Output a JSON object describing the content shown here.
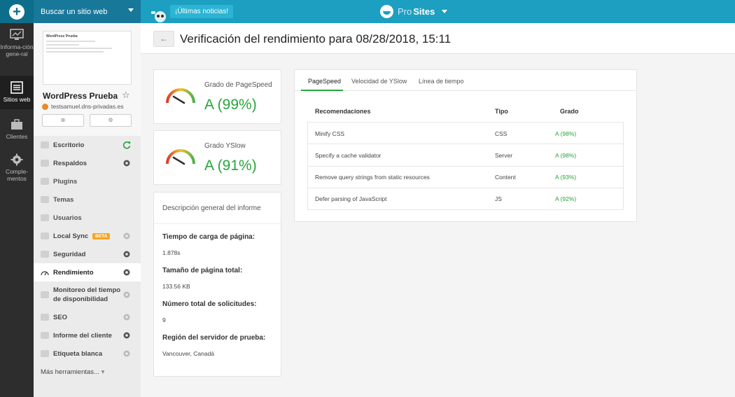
{
  "topbar": {
    "search_label": "Buscar un sitio web",
    "news_label": "¡Últimas noticias!",
    "brand_pro": "Pro",
    "brand_sites": "Sites"
  },
  "rail": {
    "items": [
      {
        "label": "Informa-ción gene-ral",
        "icon": "monitor-icon"
      },
      {
        "label": "Sitios web",
        "icon": "sites-icon"
      },
      {
        "label": "Clientes",
        "icon": "clients-icon"
      },
      {
        "label": "Comple-mentos",
        "icon": "gear-icon"
      }
    ]
  },
  "site": {
    "thumb_title": "WordPress Prueba",
    "name": "WordPress Prueba",
    "url": "testsamuel.dns-privadas.es"
  },
  "nav": {
    "items": [
      {
        "label": "Escritorio",
        "icon": "desktop-icon"
      },
      {
        "label": "Respaldos",
        "icon": "backup-icon"
      },
      {
        "label": "Plugins",
        "icon": "plugin-icon"
      },
      {
        "label": "Temas",
        "icon": "theme-icon"
      },
      {
        "label": "Usuarios",
        "icon": "users-icon"
      },
      {
        "label": "Local Sync",
        "icon": "sync-icon",
        "badge": "BETA"
      },
      {
        "label": "Seguridad",
        "icon": "shield-icon"
      },
      {
        "label": "Rendimiento",
        "icon": "speedometer-icon"
      },
      {
        "label": "Monitoreo del tiempo de disponibilidad",
        "icon": "uptime-icon"
      },
      {
        "label": "SEO",
        "icon": "megaphone-icon"
      },
      {
        "label": "Informe del cliente",
        "icon": "report-icon"
      },
      {
        "label": "Etiqueta blanca",
        "icon": "tag-icon"
      }
    ],
    "more_label": "Más herramientas..."
  },
  "page": {
    "title": "Verificación del rendimiento para 08/28/2018, 15:11",
    "back_label": "←"
  },
  "scores": [
    {
      "label": "Grado de PageSpeed",
      "value": "A (99%)",
      "percent": 99
    },
    {
      "label": "Grado YSlow",
      "value": "A (91%)",
      "percent": 91
    }
  ],
  "report": {
    "title": "Descripción general del informe",
    "fields": [
      {
        "key": "Tiempo de carga de página:",
        "value": "1.878s"
      },
      {
        "key": "Tamaño de página total:",
        "value": "133.56 KB"
      },
      {
        "key": "Número total de solicitudes:",
        "value": "9"
      },
      {
        "key": "Región del servidor de prueba:",
        "value": "Vancouver, Canadá"
      }
    ]
  },
  "results": {
    "tabs": [
      "PageSpeed",
      "Velocidad de YSlow",
      "Línea de tiempo"
    ],
    "active_tab": "PageSpeed",
    "columns": [
      "Recomendaciones",
      "Tipo",
      "Grado"
    ],
    "rows": [
      {
        "recommendation": "Minify CSS",
        "type": "CSS",
        "grade": "A (98%)"
      },
      {
        "recommendation": "Specify a cache validator",
        "type": "Server",
        "grade": "A (98%)"
      },
      {
        "recommendation": "Remove query strings from static resources",
        "type": "Content",
        "grade": "A (93%)"
      },
      {
        "recommendation": "Defer parsing of JavaScript",
        "type": "JS",
        "grade": "A (92%)"
      }
    ]
  },
  "colors": {
    "topbar": "#1c9fc1",
    "accent_green": "#27a53c",
    "beta_badge": "#f5a623"
  }
}
